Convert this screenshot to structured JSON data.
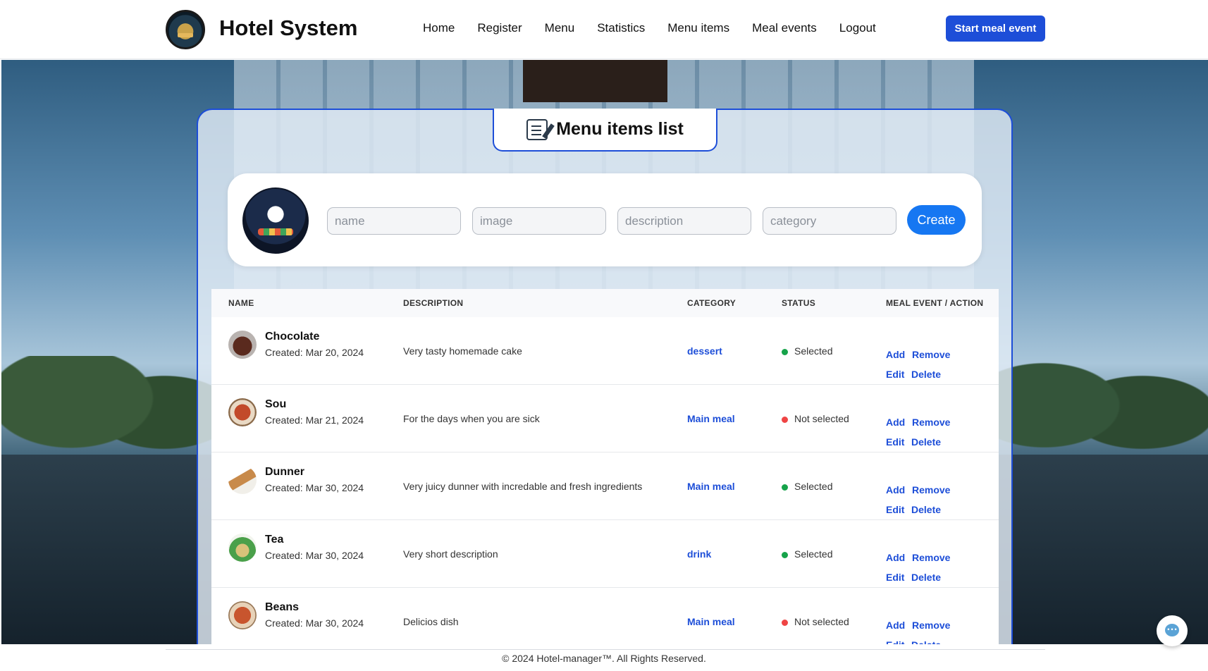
{
  "header": {
    "brand": "Hotel System",
    "nav": [
      "Home",
      "Register",
      "Menu",
      "Statistics",
      "Menu items",
      "Meal events",
      "Logout"
    ],
    "start_button": "Start meal event"
  },
  "card": {
    "title": "Menu items list"
  },
  "form": {
    "placeholders": {
      "name": "name",
      "image": "image",
      "description": "description",
      "category": "category"
    },
    "create_label": "Create"
  },
  "table": {
    "columns": [
      "NAME",
      "DESCRIPTION",
      "CATEGORY",
      "STATUS",
      "MEAL EVENT / ACTION"
    ],
    "rows": [
      {
        "name": "Chocolate",
        "created": "Created: Mar 20, 2024",
        "description": "Very tasty homemade cake",
        "category": "dessert",
        "status": "Selected",
        "status_color": "#16a34a"
      },
      {
        "name": "Sou",
        "created": "Created: Mar 21, 2024",
        "description": "For the days when you are sick",
        "category": "Main meal",
        "status": "Not selected",
        "status_color": "#ef4444"
      },
      {
        "name": "Dunner",
        "created": "Created: Mar 30, 2024",
        "description": "Very juicy dunner with incredable and fresh ingredients",
        "category": "Main meal",
        "status": "Selected",
        "status_color": "#16a34a"
      },
      {
        "name": "Tea",
        "created": "Created: Mar 30, 2024",
        "description": "Very short description",
        "category": "drink",
        "status": "Selected",
        "status_color": "#16a34a"
      },
      {
        "name": "Beans",
        "created": "Created: Mar 30, 2024",
        "description": "Delicios dish",
        "category": "Main meal",
        "status": "Not selected",
        "status_color": "#ef4444"
      }
    ],
    "actions": {
      "add": "Add",
      "remove": "Remove",
      "edit": "Edit",
      "delete": "Delete"
    }
  },
  "footer": {
    "text": "© 2024 Hotel-manager™. All Rights Reserved."
  },
  "colors": {
    "accent": "#1d4ed8",
    "create_button": "#1677f2",
    "selected": "#16a34a",
    "not_selected": "#ef4444"
  },
  "icons": {
    "title": "notepad-pencil-icon",
    "chat": "chat-bubble-icon"
  }
}
